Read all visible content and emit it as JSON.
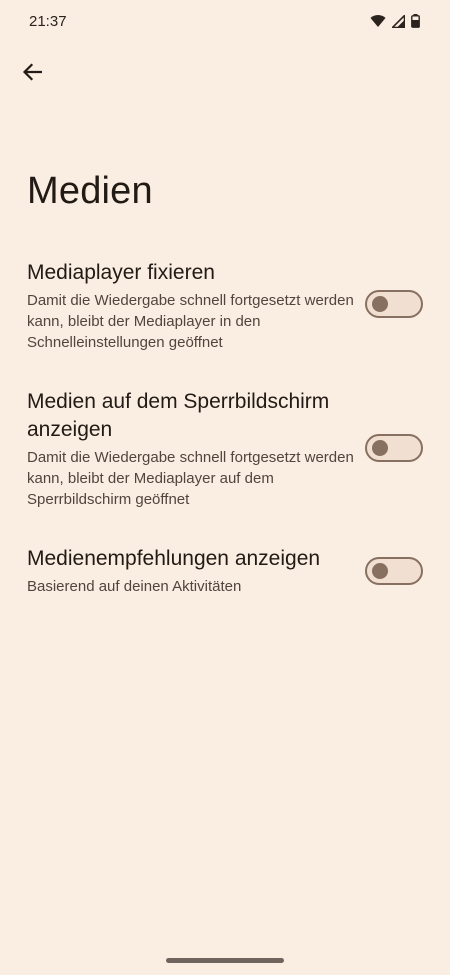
{
  "status_bar": {
    "time": "21:37",
    "icons": [
      "wifi-icon",
      "signal-icon",
      "battery-icon"
    ]
  },
  "header": {
    "back_icon": "arrow-left-icon",
    "title": "Medien"
  },
  "settings": [
    {
      "title": "Mediaplayer fixieren",
      "description": "Damit die Wiedergabe schnell fortgesetzt werden kann, bleibt der Mediaplayer in den Schnelleinstellungen geöffnet",
      "enabled": false
    },
    {
      "title": "Medien auf dem Sperrbildschirm anzeigen",
      "description": "Damit die Wiedergabe schnell fortgesetzt werden kann, bleibt der Mediaplayer auf dem Sperrbildschirm geöffnet",
      "enabled": false
    },
    {
      "title": "Medienempfehlungen anzeigen",
      "description": "Basierend auf deinen Aktivitäten",
      "enabled": false
    }
  ],
  "colors": {
    "background": "#FAEEE3",
    "toggle_outline": "#877060",
    "toggle_track": "#F1DFD2"
  }
}
